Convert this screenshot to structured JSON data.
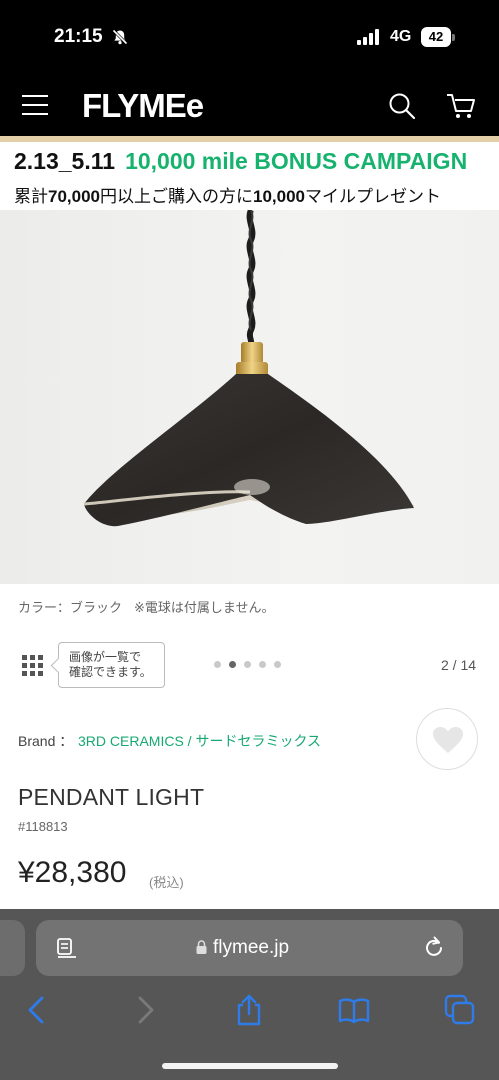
{
  "status_bar": {
    "time": "21:15",
    "network": "4G",
    "battery": "42"
  },
  "header": {
    "logo": "FLYMEe"
  },
  "banner": {
    "dates": "2.13_5.11",
    "campaign": "10,000 mile BONUS CAMPAIGN",
    "sub_a": "累計",
    "sub_b": "70,000",
    "sub_c": "円以上ご購入の方に",
    "sub_d": "10,000",
    "sub_e": "マイルプレゼント"
  },
  "gallery": {
    "color_caption": "カラー：ブラック",
    "bulb_note": "※電球は付属しません。",
    "tooltip_line1": "画像が一覧で",
    "tooltip_line2": "確認できます。",
    "page_indicator": "2 / 14",
    "dot_count": 5,
    "active_dot": 2
  },
  "product": {
    "brand_label": "Brand ：",
    "brand_name": "3RD CERAMICS / サードセラミックス",
    "title": "PENDANT LIGHT",
    "sku": "#118813",
    "price": "¥28,380",
    "tax_note": "(税込)"
  },
  "browser": {
    "url": "flymee.jp"
  },
  "colors": {
    "accent_green": "#17b36e",
    "header_bg": "#000000",
    "toolbar_bg": "#565656",
    "ios_blue": "#2e7bea"
  }
}
